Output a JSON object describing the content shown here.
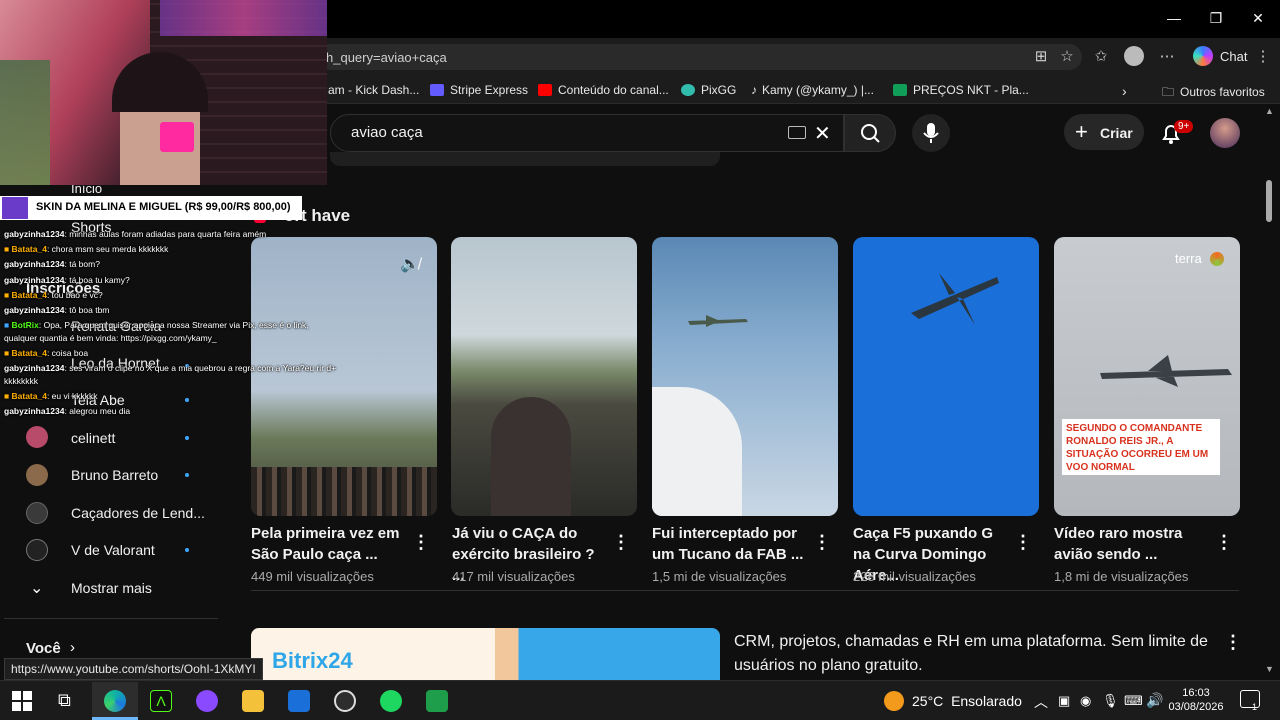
{
  "browser": {
    "url": "h_query=aviao+caça",
    "chat_label": "Chat",
    "bookmarks": [
      {
        "label": "am - Kick Dash...",
        "color": "#53fc18"
      },
      {
        "label": "Stripe Express",
        "color": "#635bff"
      },
      {
        "label": "Conteúdo do canal...",
        "color": "#ff0000"
      },
      {
        "label": "PixGG",
        "color": "#32bcad"
      },
      {
        "label": "Kamy (@ykamy_) |...",
        "color": "#ffffff"
      },
      {
        "label": "PREÇOS NKT - Pla...",
        "color": "#0f9d58"
      }
    ],
    "other_favorites": "Outros favoritos"
  },
  "youtube": {
    "search_value": "aviao caça",
    "create_label": "Criar",
    "notifications_badge": "9+",
    "shorts_heading": "ort   have",
    "sidebar": {
      "overlay_items": [
        "Início",
        "Shorts",
        "Inscrições",
        "Renata Garcia",
        "Leo da Hornet",
        "Tela Abe"
      ],
      "subscriptions": [
        {
          "label": "celinett",
          "dot": true,
          "color": "#b84a6a"
        },
        {
          "label": "Bruno Barreto",
          "dot": true,
          "color": "#8a6a4a"
        },
        {
          "label": "Caçadores de Lend...",
          "dot": false,
          "color": "#3a3a3a"
        },
        {
          "label": "V de Valorant",
          "dot": true,
          "color": "#222222"
        }
      ],
      "show_more": "Mostrar mais",
      "voce": "Você"
    },
    "shorts": [
      {
        "title": "Pela primeira vez em São Paulo caça ...",
        "views": "449 mil visualizações"
      },
      {
        "title": "Já viu o CAÇA do exército brasileiro ? ...",
        "views": "417 mil visualizações"
      },
      {
        "title": "Fui interceptado por um Tucano da FAB ...",
        "views": "1,5 mi de visualizações"
      },
      {
        "title": "Caça F5 puxando G na Curva Domingo Aére...",
        "views": "228 mil visualizações"
      },
      {
        "title": "Vídeo raro mostra avião sendo ...",
        "views": "1,8 mi de visualizações"
      }
    ],
    "short5_overlay": "SEGUNDO O COMANDANTE RONALDO REIS JR., A SITUAÇÃO OCORREU EM UM VOO NORMAL",
    "short5_brand": "terra",
    "ad": {
      "logo": "Bitrix24",
      "text": "CRM, projetos, chamadas e RH em uma plataforma. Sem limite de usuários no plano gratuito."
    }
  },
  "stream_overlay": {
    "banner": "SKIN DA MELINA E MIGUEL (R$ 99,00/R$ 800,00)",
    "chat": [
      {
        "user": "gabyzinha1234",
        "msg": ": minhas aulas foram adiadas para quarta feira amém"
      },
      {
        "user": "Batata_4",
        "msg": ": chora msm seu merda kkkkkkk"
      },
      {
        "user": "gabyzinha1234",
        "msg": ": tá bom?"
      },
      {
        "user": "gabyzinha1234",
        "msg": ": tá boa tu kamy?"
      },
      {
        "user": "Batata_4",
        "msg": ": tou bao e vc?"
      },
      {
        "user": "gabyzinha1234",
        "msg": ": tô boa tbm"
      },
      {
        "user": "BotRix",
        "msg": ": Opa, Para quem quiser apoiar a nossa Streamer via Pix, esse é o link,"
      },
      {
        "user": "",
        "msg": "qualquer quantia é bem vinda: https://pixgg.com/ykamy_"
      },
      {
        "user": "Batata_4",
        "msg": ": coisa boa"
      },
      {
        "user": "gabyzinha1234",
        "msg": ": ses viram o clipe no X que a mia quebrou a regra com a Yara?eu rir d+"
      },
      {
        "user": "",
        "msg": "kkkkkkkk"
      },
      {
        "user": "Batata_4",
        "msg": ": eu vi kkkkkk"
      },
      {
        "user": "gabyzinha1234",
        "msg": ": alegrou meu dia"
      }
    ]
  },
  "status_url": "https://www.youtube.com/shorts/OohI-1XkMYI",
  "taskbar": {
    "temperature": "25°C",
    "weather": "Ensolarado",
    "time": "16:03",
    "date": "03/08/2026",
    "notification_count": "1"
  }
}
